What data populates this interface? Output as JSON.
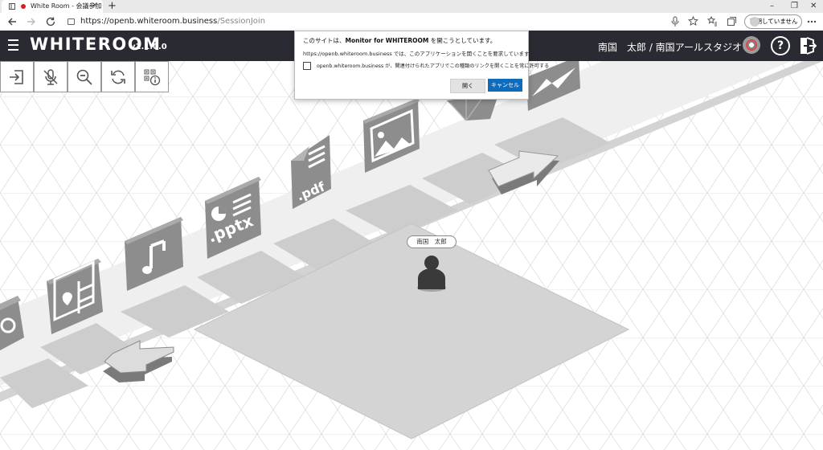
{
  "browser": {
    "tab_title": "White Room - 会議参加",
    "tab_close": "×",
    "new_tab": "+",
    "window_controls": [
      "–",
      "❐",
      "✕"
    ],
    "url_host": "https://openb.whiteroom.business",
    "url_path": "/SessionJoin",
    "sync_label": "同期していません",
    "nav_icons": [
      "back-icon",
      "forward-icon",
      "reload-icon",
      "lock-icon",
      "mic-icon",
      "star-icon",
      "favorites-icon",
      "collections-icon",
      "more-icon"
    ]
  },
  "app": {
    "logo": "WHITEROOM",
    "version": "v1.1.0.0",
    "user_label": "南国　太郎 / 南国アールスタジオ"
  },
  "toolbar": {
    "buttons": [
      "exit-room-icon",
      "mic-muted-icon",
      "zoom-out-icon",
      "rotate-icon",
      "qr-info-icon"
    ]
  },
  "scene": {
    "file_labels": [
      ".pptx",
      ".pdf"
    ],
    "avatar_name": "南国　太郎"
  },
  "dialog": {
    "title_prefix": "このサイトは、",
    "title_app": "Monitor for WHITEROOM",
    "title_suffix": " を開こうとしています。",
    "message": "https://openb.whiteroom.business では、このアプリケーションを開くことを要求しています。",
    "checkbox_label": "openb.whiteroom.business が、関連付けられたアプリでこの種類のリンクを開くことを常に許可する",
    "open_button": "開く",
    "cancel_button": "キャンセル"
  },
  "colors": {
    "header_bg": "#2a2a32",
    "accent_blue": "#0f6cbd",
    "recording_red": "#d62020"
  }
}
